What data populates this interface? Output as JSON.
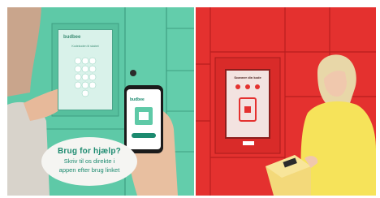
{
  "left_photo": {
    "kiosk_brand": "budbee",
    "kiosk_heading": "Kodekoden til skabet",
    "phone_app_name": "budbee",
    "help_sign": {
      "title": "Brug for hjælp?",
      "line1": "Skriv til os direkte i",
      "line2": "appen efter brug linket"
    },
    "locker_color": "#5ec9a7",
    "screen_color": "#d9f2ea",
    "text_color": "#1c8a6f"
  },
  "right_photo": {
    "kiosk_heading": "Scanner din kode",
    "locker_color": "#e4312f",
    "screen_color": "#f3e3e0",
    "sweater_color": "#f6e35a",
    "parcel_color": "#f3d97a",
    "hair_color": "#e8d7a8"
  }
}
